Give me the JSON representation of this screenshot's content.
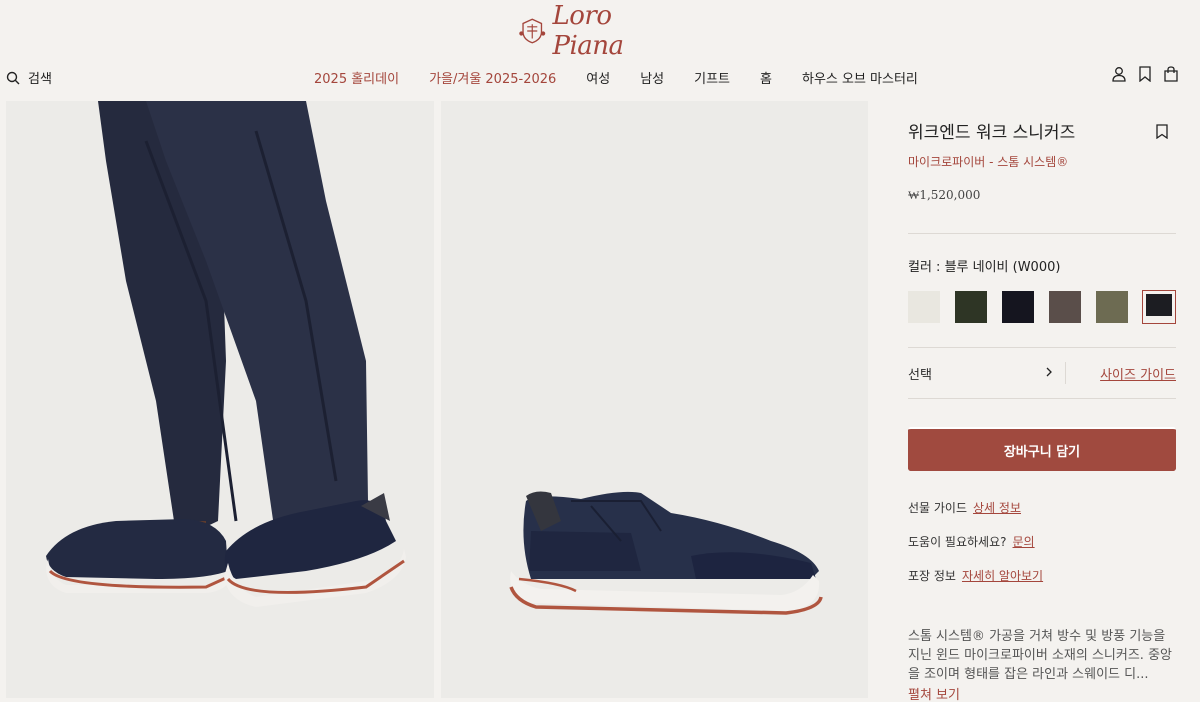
{
  "brand": {
    "name": "Loro Piana"
  },
  "header": {
    "search_label": "검색",
    "nav": [
      {
        "label": "2025 홀리데이",
        "accent": true
      },
      {
        "label": "가을/겨울 2025-2026",
        "accent": true
      },
      {
        "label": "여성",
        "accent": false
      },
      {
        "label": "남성",
        "accent": false
      },
      {
        "label": "기프트",
        "accent": false
      },
      {
        "label": "홈",
        "accent": false
      },
      {
        "label": "하우스 오브 마스터리",
        "accent": false
      }
    ]
  },
  "product": {
    "title": "위크엔드 워크 스니커즈",
    "subtitle": "마이크로파이버 - 스톰 시스템®",
    "price": "₩1,520,000",
    "color_label": "컬러 : 블루 네이비 (W000)",
    "swatches": [
      {
        "color": "#e9e7e0",
        "selected": false
      },
      {
        "color": "#2e3525",
        "selected": false
      },
      {
        "color": "#15151f",
        "selected": false
      },
      {
        "color": "#5a4e4a",
        "selected": false
      },
      {
        "color": "#6d6b52",
        "selected": false
      },
      {
        "color": "#1c1d22",
        "selected": true
      }
    ],
    "select_label": "선택",
    "size_guide": "사이즈 가이드",
    "add_to_cart": "장바구니 담기",
    "info": {
      "gift_label": "선물 가이드",
      "gift_link": "상세 정보",
      "help_label": "도움이 필요하세요?",
      "help_link": "문의",
      "packaging_label": "포장 정보",
      "packaging_link": "자세히 알아보기"
    },
    "description": "스톰 시스템® 가공을 거쳐 방수 및 방풍 기능을 지닌 윈드 마이크로파이버 소재의 스니커즈. 중앙을 조이며 형태를 잡은 라인과 스웨이드 디...",
    "read_more": "펼쳐 보기"
  },
  "colors": {
    "accent": "#a4463c",
    "background": "#f4f2ef"
  }
}
